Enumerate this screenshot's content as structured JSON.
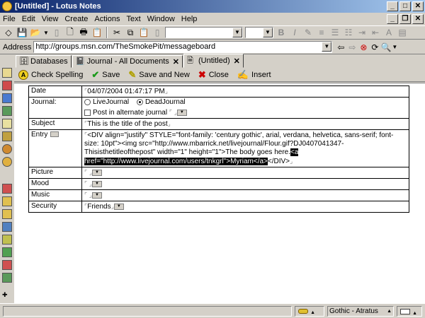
{
  "window": {
    "title": "[Untitled] - Lotus Notes"
  },
  "menu": [
    "File",
    "Edit",
    "View",
    "Create",
    "Actions",
    "Text",
    "Window",
    "Help"
  ],
  "address": {
    "label": "Address",
    "url": "http://groups.msn.com/TheSmokePit/messageboard"
  },
  "tabs": [
    {
      "label": "Databases",
      "icon": "databases-icon"
    },
    {
      "label": "Journal - All Documents",
      "icon": "journal-icon"
    },
    {
      "label": "(Untitled)",
      "icon": "document-icon"
    }
  ],
  "actions": [
    {
      "label": "Check Spelling",
      "icon": "spellcheck-icon"
    },
    {
      "label": "Save",
      "icon": "checkmark-icon"
    },
    {
      "label": "Save and New",
      "icon": "save-new-icon"
    },
    {
      "label": "Close",
      "icon": "close-x-icon"
    },
    {
      "label": "Insert",
      "icon": "insert-icon"
    }
  ],
  "form": {
    "date_label": "Date",
    "date_value": "04/07/2004 01:47:17 PM",
    "journal_label": "Journal:",
    "journal_opt1": "LiveJournal",
    "journal_opt2": "DeadJournal",
    "journal_alt": "Post in alternate journal",
    "subject_label": "Subject",
    "subject_value": "This is the title of the post",
    "entry_label": "Entry",
    "entry_text": "<DIV align=\"justify\" STYLE=\"font-family: 'century gothic', arial, verdana, helvetica, sans-serif; font-size: 10pt\"><img src=\"http://www.mbarrick.net/livejournal/Flour.gif?DJ0407041347-Thisisthetitleofthepost\" width=\"1\" height=\"1\">The body goes here.",
    "entry_selected": "<a href=\"http://www.livejournal.com/users/tnkgrl\">Myriam</a>",
    "entry_end": "</DIV>",
    "picture_label": "Picture",
    "mood_label": "Mood",
    "music_label": "Music",
    "security_label": "Security",
    "security_value": "Friends"
  },
  "status": {
    "font": "Gothic - Atratus"
  }
}
